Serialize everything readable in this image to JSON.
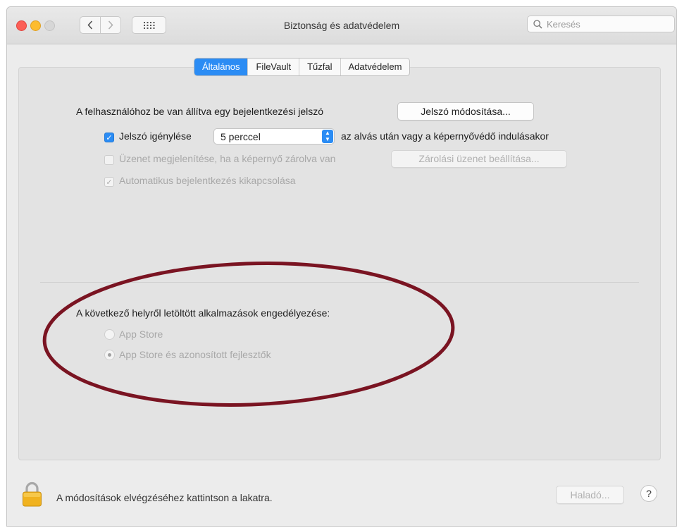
{
  "window": {
    "title": "Biztonság és adatvédelem",
    "search_placeholder": "Keresés"
  },
  "tabs": [
    {
      "label": "Általános",
      "active": true
    },
    {
      "label": "FileVault",
      "active": false
    },
    {
      "label": "Tűzfal",
      "active": false
    },
    {
      "label": "Adatvédelem",
      "active": false
    }
  ],
  "general": {
    "password_label": "A felhasználóhoz be van állítva egy bejelentkezési jelszó",
    "change_password_button": "Jelszó módosítása...",
    "require_password": {
      "label": "Jelszó igénylése",
      "checked": true,
      "delay_value": "5 perccel",
      "suffix": "az alvás után vagy a képernyővédő indulásakor"
    },
    "show_message": {
      "label": "Üzenet megjelenítése, ha a képernyő zárolva van",
      "checked": false,
      "enabled": false,
      "button": "Zárolási üzenet beállítása..."
    },
    "disable_auto_login": {
      "label": "Automatikus bejelentkezés kikapcsolása",
      "checked": true,
      "enabled": false
    },
    "allow_apps": {
      "label": "A következő helyről letöltött alkalmazások engedélyezése:",
      "options": [
        {
          "label": "App Store",
          "selected": false
        },
        {
          "label": "App Store és azonosított fejlesztők",
          "selected": true
        }
      ]
    }
  },
  "footer": {
    "lock_text": "A módosítások elvégzéséhez kattintson a lakatra.",
    "advanced_button": "Haladó...",
    "help_label": "?"
  },
  "colors": {
    "accent": "#2b8cf4",
    "annotation": "#7a1422"
  }
}
